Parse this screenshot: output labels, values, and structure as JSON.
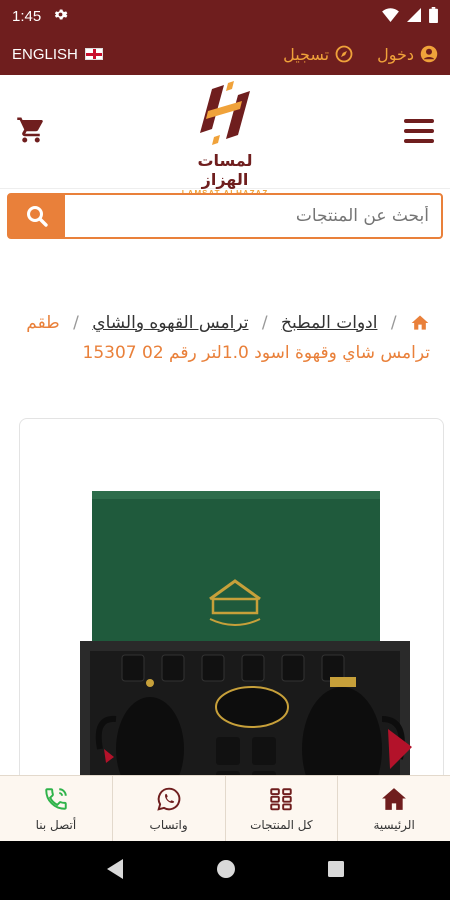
{
  "status_bar": {
    "time": "1:45"
  },
  "top_bar": {
    "language_label": "ENGLISH",
    "register_label": "تسجيل",
    "login_label": "دخول"
  },
  "logo": {
    "arabic_name": "لمسات الهزاز",
    "english_name": "LAMSAT ALHAZAZ"
  },
  "search": {
    "placeholder": "أبحث عن المنتجات"
  },
  "breadcrumb": {
    "items": [
      "ادوات المطبخ",
      "ترامس القهوه والشاي"
    ],
    "current": "طقم ترامس شاي وقهوة اسود 1.0لتر رقم 02 15307"
  },
  "bottom_nav": {
    "items": [
      {
        "label": "أتصل بنا",
        "icon": "phone-icon"
      },
      {
        "label": "واتساب",
        "icon": "whatsapp-icon"
      },
      {
        "label": "كل المنتجات",
        "icon": "grid-icon"
      },
      {
        "label": "الرئيسية",
        "icon": "home-icon"
      }
    ]
  },
  "colors": {
    "brand": "#6f1e1e",
    "accent": "#e9803a",
    "green": "#2fb34a"
  }
}
